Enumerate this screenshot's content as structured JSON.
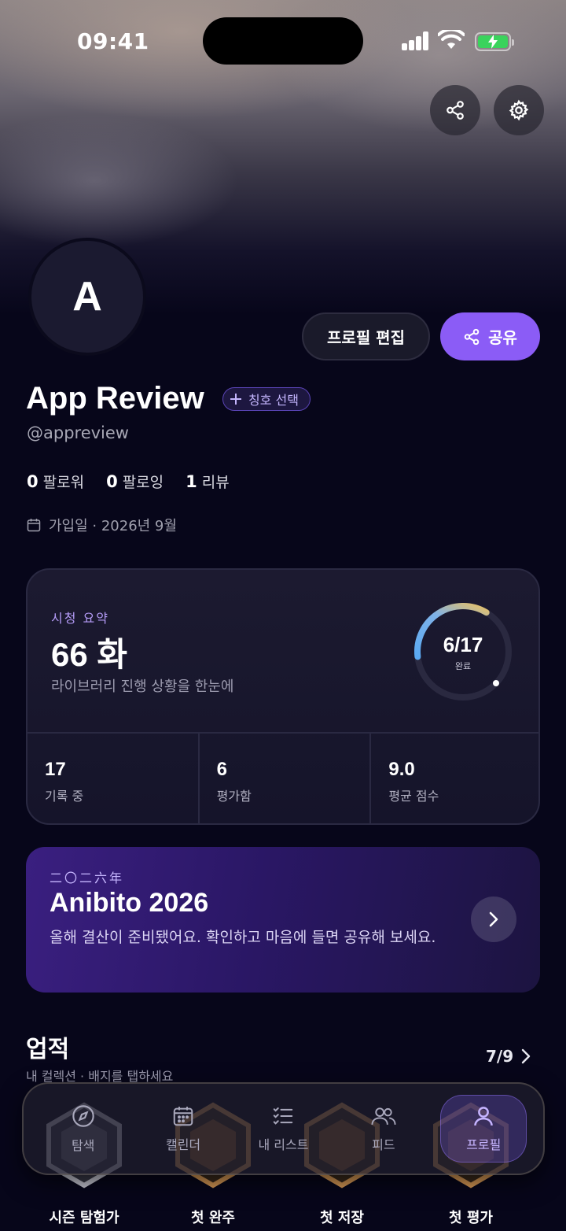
{
  "status_bar": {
    "time": "09:41"
  },
  "profile": {
    "avatar_initial": "A",
    "name": "App Review",
    "title_chip": "칭호 선택",
    "handle": "@appreview",
    "followers_count": "0",
    "followers_label": "팔로워",
    "following_count": "0",
    "following_label": "팔로잉",
    "reviews_count": "1",
    "reviews_label": "리뷰",
    "joined": "가입일 · 2026년 9월",
    "edit_label": "프로필 편집",
    "share_label": "공유"
  },
  "summary": {
    "label": "시청 요약",
    "value": "66 화",
    "subtitle": "라이브러리 진행 상황을 한눈에",
    "progress_text": "6/17",
    "progress_fraction": 0.353,
    "progress_label": "완료",
    "stats": [
      {
        "value": "17",
        "label": "기록 중"
      },
      {
        "value": "6",
        "label": "평가함"
      },
      {
        "value": "9.0",
        "label": "평균 점수"
      }
    ]
  },
  "recap": {
    "kicker": "二〇二六年",
    "title": "Anibito 2026",
    "description": "올해 결산이 준비됐어요. 확인하고 마음에 들면 공유해 보세요."
  },
  "achievements": {
    "title": "업적",
    "subtitle": "내 컬렉션 · 배지를 탭하세요",
    "count": "7/9",
    "badges": [
      {
        "name": "시즌 탐험가",
        "color": "#c8c8d4"
      },
      {
        "name": "첫 완주",
        "color": "#d99a56"
      },
      {
        "name": "첫 저장",
        "color": "#d99a56"
      },
      {
        "name": "첫 평가",
        "color": "#d99a56"
      }
    ]
  },
  "tabbar": {
    "items": [
      {
        "label": "탐색",
        "icon": "compass-icon"
      },
      {
        "label": "캘린더",
        "icon": "calendar-icon"
      },
      {
        "label": "내 리스트",
        "icon": "checklist-icon"
      },
      {
        "label": "피드",
        "icon": "people-icon"
      },
      {
        "label": "프로필",
        "icon": "person-icon"
      }
    ],
    "active_index": 4
  },
  "colors": {
    "accent": "#8b5cf6",
    "background": "#07061a",
    "ring_blue": "#5aa9f2",
    "ring_yellow": "#f2c25a"
  }
}
